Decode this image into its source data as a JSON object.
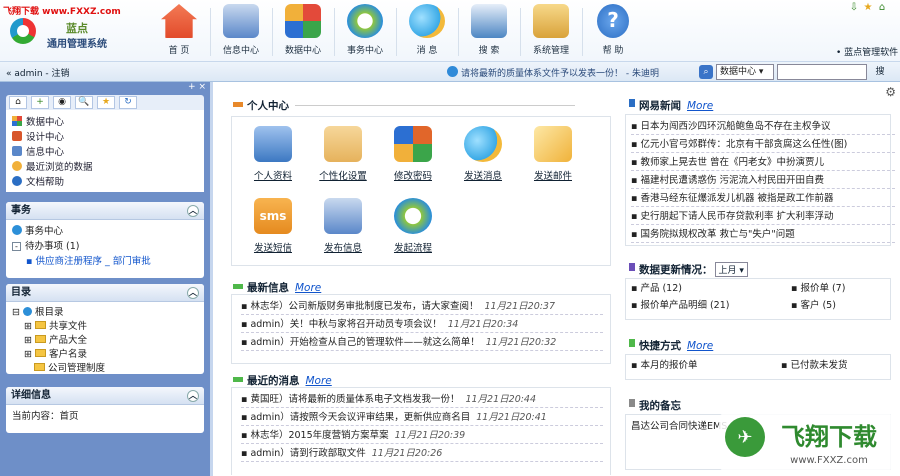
{
  "watermark": "飞翔下载 www.FXXZ.com",
  "brand": {
    "line1": "蓝点",
    "line2": "通用管理系统"
  },
  "nav": [
    {
      "label": "首 页",
      "icon": "home-icon",
      "color": "#e24b2b"
    },
    {
      "label": "信息中心",
      "icon": "people-icon",
      "color": "#5a87c9"
    },
    {
      "label": "数据中心",
      "icon": "data-grid-icon",
      "color": "#3ba54a"
    },
    {
      "label": "事务中心",
      "icon": "globe-icon",
      "color": "#2c8fd8"
    },
    {
      "label": "消 息",
      "icon": "chat-bubbles-icon",
      "color": "#39a9e6"
    },
    {
      "label": "搜 索",
      "icon": "magnifier-icon",
      "color": "#4d86c3"
    },
    {
      "label": "系统管理",
      "icon": "folders-icon",
      "color": "#d9a23a"
    },
    {
      "label": "帮 助",
      "icon": "help-icon",
      "color": "#2b6ec4"
    }
  ],
  "topright": {
    "sysadmin": "• 蓝点管理软件"
  },
  "status": {
    "user": "« admin - 注销",
    "tip": "请将最新的质量体系文件予以发表一份！ - 朱迪明",
    "search_scope": "数据中心",
    "search_btn": "搜"
  },
  "sidebar": {
    "pin": "+ ×",
    "tools": [
      "⌂",
      "+",
      "◉",
      "🔍",
      "★",
      "↻"
    ],
    "quick": [
      {
        "label": "数据中心",
        "icon": "grid-icon"
      },
      {
        "label": "设计中心",
        "icon": "design-icon"
      },
      {
        "label": "信息中心",
        "icon": "info-icon"
      },
      {
        "label": "最近浏览的数据",
        "icon": "recent-icon"
      },
      {
        "label": "文档帮助",
        "icon": "help-doc-icon"
      }
    ],
    "affairs": {
      "title": "事务",
      "items": [
        "事务中心",
        "待办事项 (1)"
      ],
      "sub": "▪ 供应商注册程序 _ 部门审批"
    },
    "directory": {
      "title": "目录",
      "root": "根目录",
      "folders": [
        "共享文件",
        "产品大全",
        "客户名录",
        "公司管理制度"
      ]
    },
    "detail": {
      "title": "详细信息",
      "text": "当前内容：首页"
    }
  },
  "main": {
    "personal": {
      "title": "个人中心",
      "tiles": [
        {
          "label": "个人资料",
          "icon": "profile-card-icon",
          "color": "#3c78c2"
        },
        {
          "label": "个性化设置",
          "icon": "settings-face-icon",
          "color": "#e6b25c"
        },
        {
          "label": "修改密码",
          "icon": "windows-key-icon",
          "color": "#e1662a"
        },
        {
          "label": "发送消息",
          "icon": "chat-bubbles-icon",
          "color": "#39a9e6"
        },
        {
          "label": "发送邮件",
          "icon": "envelope-icon",
          "color": "#f0b23a"
        },
        {
          "label": "发送短信",
          "icon": "sms-icon",
          "color": "#e58a1f"
        },
        {
          "label": "发布信息",
          "icon": "people-icon",
          "color": "#5a87c9"
        },
        {
          "label": "发起流程",
          "icon": "flow-globe-icon",
          "color": "#2c8fd8"
        }
      ]
    },
    "latest": {
      "title": "最新信息",
      "more": "More",
      "items": [
        {
          "text": "▪ 林志华）公司新版财务审批制度已发布，请大家查阅！",
          "date": "11月21日20:37"
        },
        {
          "text": "▪ admin）关！中秋与家将召开动员专项会议！",
          "date": "11月21日20:34"
        },
        {
          "text": "▪ admin）开始检查从自己的管理软件——就这么简单！",
          "date": "11月21日20:32"
        }
      ]
    },
    "recent_msgs": {
      "title": "最近的消息",
      "more": "More",
      "items": [
        {
          "text": "▪ 黄国旺）请将最新的质量体系电子文档发我一份！",
          "date": "11月21日20:44"
        },
        {
          "text": "▪ admin）请按照今天会议评审结果，更新供应商名目",
          "date": "11月21日20:41"
        },
        {
          "text": "▪ 林志华）2015年度营销方案草案",
          "date": "11月21日20:39"
        },
        {
          "text": "▪ admin）请到行政部取文件",
          "date": "11月21日20:26"
        }
      ]
    },
    "news": {
      "title": "网易新闻",
      "more": "More",
      "items": [
        "▪ 日本为闯西沙四环沉船鲍鱼岛不存在主权争议",
        "▪ 亿元小官弓郊群传：北京有干部贪腐这么任性(图)",
        "▪ 教师家上晃去世 曾在《円老女》中扮演贾儿",
        "▪ 福建村民遭诱惑伤 污泥流入村民田开田自费",
        "▪ 香港马经东征爆派发儿机器 被指是政工作前器",
        "▪ 史行朋起下请人民币存贷款利率 扩大利率浮动",
        "▪ 国务院拟规权改革 救亡与\"失户\"问题"
      ]
    },
    "data_update": {
      "title": "数据更新情况：",
      "period": "上月",
      "items": [
        {
          "label": "▪ 产品 (12)"
        },
        {
          "label": "▪ 报价单 (7)"
        },
        {
          "label": "▪ 报价单产品明细 (21)"
        },
        {
          "label": "▪ 客户 (5)"
        }
      ]
    },
    "shortcuts": {
      "title": "快捷方式",
      "more": "More",
      "items": [
        "▪ 本月的报价单",
        "▪ 已付款未发货"
      ]
    },
    "remarks": {
      "title": "我的备忘",
      "text": "昌达公司合同快递EMS"
    },
    "fly_logo": "飞翔下载 www.FXXZ.com"
  }
}
